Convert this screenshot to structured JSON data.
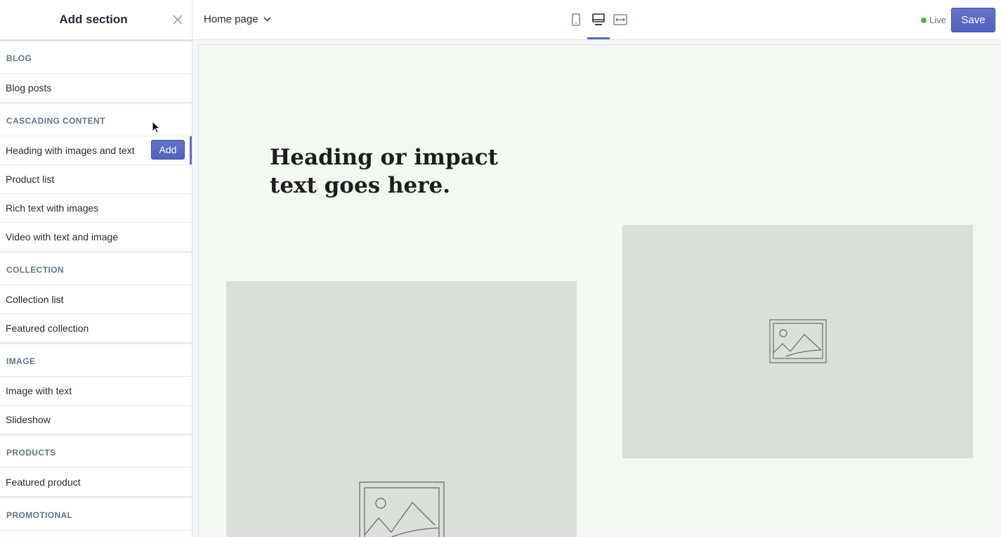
{
  "sidebar": {
    "title": "Add section",
    "categories": {
      "blog": {
        "label": "BLOG",
        "items": [
          "Blog posts"
        ]
      },
      "cascading": {
        "label": "CASCADING CONTENT",
        "items": [
          "Heading with images and text",
          "Product list",
          "Rich text with images",
          "Video with text and image"
        ]
      },
      "collection": {
        "label": "COLLECTION",
        "items": [
          "Collection list",
          "Featured collection"
        ]
      },
      "image": {
        "label": "IMAGE",
        "items": [
          "Image with text",
          "Slideshow"
        ]
      },
      "products": {
        "label": "PRODUCTS",
        "items": [
          "Featured product"
        ]
      },
      "promotional": {
        "label": "PROMOTIONAL",
        "items": []
      }
    },
    "add_label": "Add"
  },
  "topbar": {
    "page_select": "Home page",
    "devices": [
      "mobile",
      "desktop",
      "full-width"
    ],
    "selected_device": "desktop",
    "status": "Live",
    "save_label": "Save"
  },
  "preview": {
    "heading": "Heading or impact text goes here."
  },
  "colors": {
    "accent": "#5c6ac4",
    "live_dot": "#50b83c",
    "preview_bg": "#f4f8f2",
    "placeholder_bg": "#dadfd8"
  }
}
